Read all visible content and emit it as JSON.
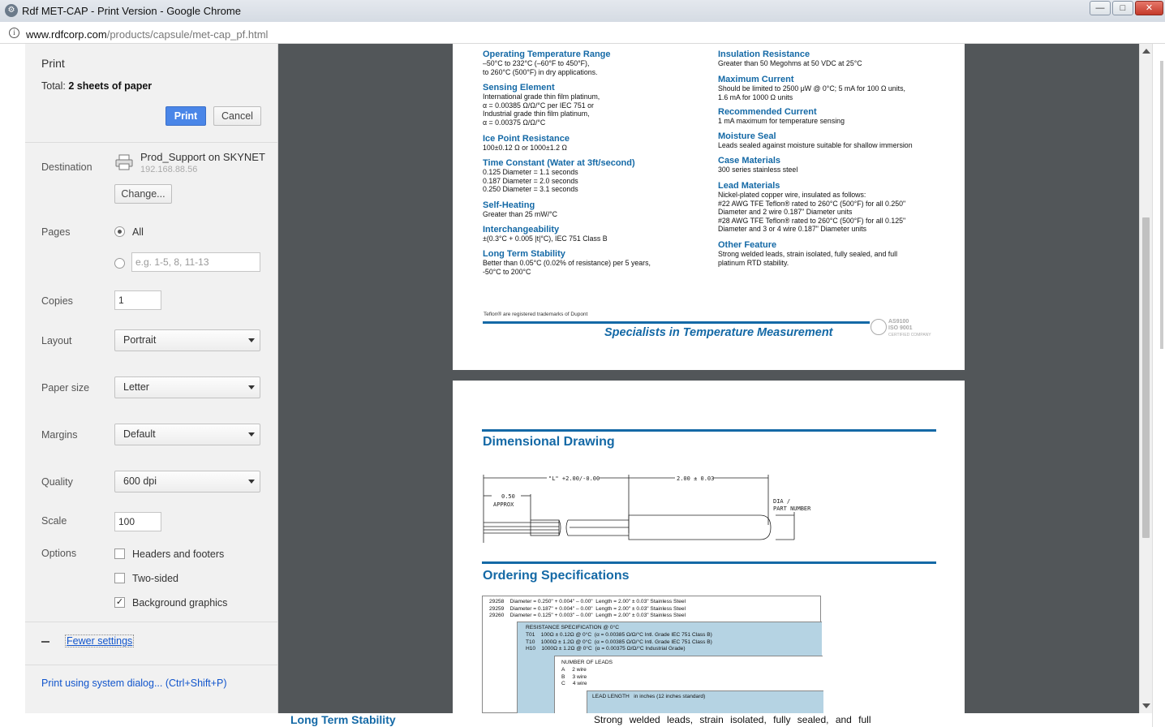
{
  "window": {
    "title": "Rdf MET-CAP - Print Version - Google Chrome",
    "minimize_glyph": "—",
    "maximize_glyph": "□",
    "close_glyph": "✕"
  },
  "address": {
    "host": "www.rdfcorp.com",
    "path": "/products/capsule/met-cap_pf.html"
  },
  "print_panel": {
    "heading": "Print",
    "total_label": "Total: ",
    "total_value": "2 sheets of paper",
    "print_button": "Print",
    "cancel_button": "Cancel",
    "destination_label": "Destination",
    "destination_name": "Prod_Support on SKYNET",
    "destination_ip": "192.168.88.56",
    "change_button": "Change...",
    "pages_label": "Pages",
    "pages_all": "All",
    "pages_placeholder": "e.g. 1-5, 8, 11-13",
    "copies_label": "Copies",
    "copies_value": "1",
    "layout_label": "Layout",
    "layout_value": "Portrait",
    "paper_label": "Paper size",
    "paper_value": "Letter",
    "margins_label": "Margins",
    "margins_value": "Default",
    "quality_label": "Quality",
    "quality_value": "600 dpi",
    "scale_label": "Scale",
    "scale_value": "100",
    "options_label": "Options",
    "opt_headers": "Headers and footers",
    "opt_headers_checked": false,
    "opt_twosided": "Two-sided",
    "opt_twosided_checked": false,
    "opt_background": "Background graphics",
    "opt_background_checked": true,
    "fewer_settings": "Fewer settings",
    "system_dialog": "Print using system dialog... (Ctrl+Shift+P)"
  },
  "preview": {
    "page1": {
      "left_specs": [
        {
          "heading": "Operating Temperature Range",
          "text": "–50°C to 232°C (–60°F to 450°F),\nto 260°C (500°F) in dry applications."
        },
        {
          "heading": "Sensing Element",
          "text": "International grade thin film platinum,\nα = 0.00385 Ω/Ω/°C per IEC 751 or\nIndustrial grade thin film platinum,\nα = 0.00375 Ω/Ω/°C"
        },
        {
          "heading": "Ice Point Resistance",
          "text": "100±0.12 Ω or 1000±1.2 Ω"
        },
        {
          "heading": "Time Constant (Water at 3ft/second)",
          "text": "0.125 Diameter = 1.1 seconds\n0.187 Diameter = 2.0 seconds\n0.250 Diameter = 3.1 seconds"
        },
        {
          "heading": "Self-Heating",
          "text": "Greater than 25 mW/°C"
        },
        {
          "heading": "Interchangeability",
          "text": "±(0.3°C + 0.005 |t|°C), IEC 751 Class B"
        },
        {
          "heading": "Long Term Stability",
          "text": "Better than 0.05°C (0.02% of resistance) per 5 years,\n-50°C to 200°C"
        }
      ],
      "right_specs": [
        {
          "heading": "Insulation Resistance",
          "text": "Greater than 50 Megohms at 50 VDC at 25°C"
        },
        {
          "heading": "Maximum Current",
          "text": "Should be limited to 2500 μW @ 0°C; 5 mA for 100 Ω units,\n1.6 mA for 1000 Ω units"
        },
        {
          "heading": "Recommended Current",
          "text": "1 mA maximum for temperature sensing"
        },
        {
          "heading": "Moisture Seal",
          "text": "Leads sealed against moisture suitable for shallow immersion"
        },
        {
          "heading": "Case Materials",
          "text": "300 series stainless steel"
        },
        {
          "heading": "Lead Materials",
          "text": "Nickel-plated copper wire, insulated as follows:\n#22 AWG TFE Teflon® rated to 260°C (500°F) for all 0.250\"\nDiameter and 2 wire 0.187\" Diameter units\n#28 AWG TFE Teflon® rated to 260°C (500°F) for all 0.125\"\nDiameter and 3 or 4 wire 0.187\" Diameter units"
        },
        {
          "heading": "Other Feature",
          "text": "Strong welded leads, strain isolated, fully sealed, and full\nplatinum RTD stability."
        }
      ],
      "footnote": "Teflon® are registered trademarks of Dupont",
      "slogan": "Specialists in Temperature Measurement",
      "cert_line1": "AS9100",
      "cert_line2": "ISO 9001",
      "cert_line3": "CERTIFIED COMPANY"
    },
    "page2": {
      "drawing_title": "Dimensional Drawing",
      "drawing_labels": {
        "length": "\"L\" +2.00/-0.00",
        "tip": "2.00 ± 0.03",
        "approx_value": "0.50",
        "approx_word": "APPROX",
        "dia": "DIA /",
        "part": "PART NUMBER"
      },
      "ordering_title": "Ordering Specifications",
      "models": [
        "29258    Diameter = 0.250\" + 0.004\" – 0.00\"  Length = 2.00\" ± 0.03\" Stainless Steel",
        "29259    Diameter = 0.187\" + 0.004\" – 0.00\"  Length = 2.00\" ± 0.03\" Stainless Steel",
        "29260    Diameter = 0.125\" + 0.003\" – 0.00\"  Length = 2.00\" ± 0.03\" Stainless Steel"
      ],
      "resistance_title": "RESISTANCE SPECIFICATION @ 0°C",
      "resistance_rows": [
        "T01    100Ω ± 0.12Ω @ 0°C  (α = 0.00385 Ω/Ω/°C Intl. Grade IEC 751 Class B)",
        "T10    1000Ω ± 1.2Ω @ 0°C  (α = 0.00385 Ω/Ω/°C Intl. Grade IEC 751 Class B)",
        "H10    1000Ω ± 1.2Ω @ 0°C  (α = 0.00375 Ω/Ω/°C Industrial Grade)"
      ],
      "leads_title": "NUMBER OF LEADS",
      "leads_rows": [
        "A     2 wire",
        "B     3 wire",
        "C     4 wire"
      ],
      "lead_length": "LEAD LENGTH   in inches (12 inches standard)"
    }
  },
  "bottom_strip": {
    "left": "Long Term Stability",
    "right": "Strong welded leads, strain isolated, fully sealed, and full"
  }
}
